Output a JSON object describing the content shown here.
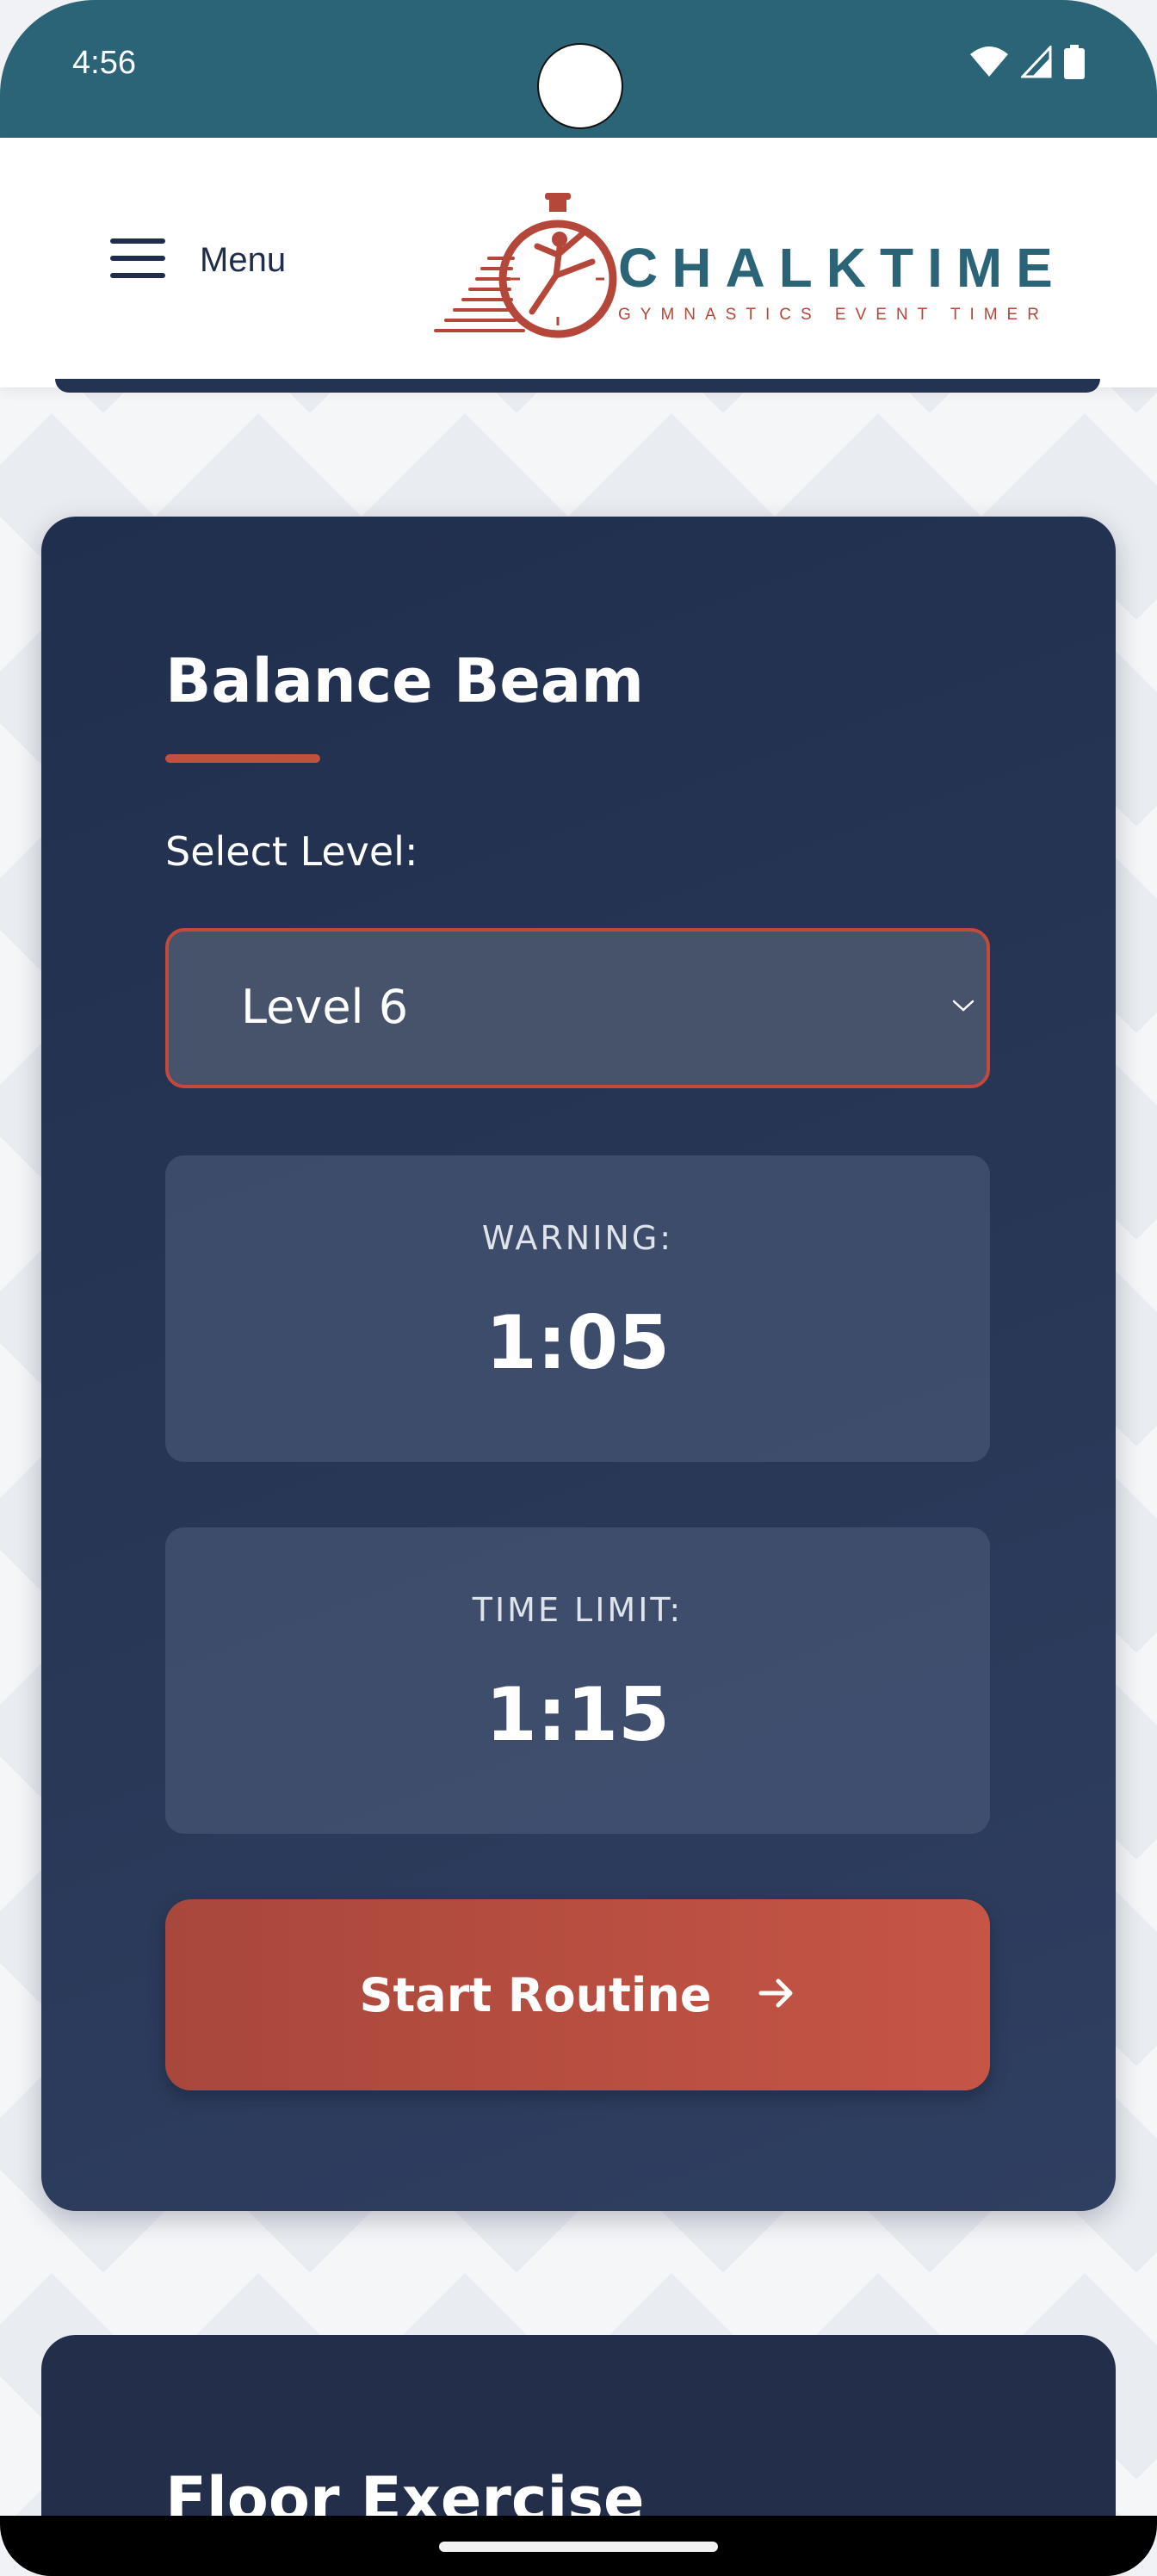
{
  "status_bar": {
    "time": "4:56"
  },
  "header": {
    "menu_label": "Menu",
    "logo_title": "CHALKTIME",
    "logo_subtitle": "GYMNASTICS EVENT TIMER"
  },
  "event_card": {
    "title": "Balance Beam",
    "select_label": "Select Level:",
    "selected_level": "Level 6",
    "warning_label": "WARNING:",
    "warning_time": "1:05",
    "limit_label": "TIME LIMIT:",
    "limit_time": "1:15",
    "start_button_label": "Start Routine"
  },
  "next_card": {
    "title": "Floor Exercise"
  },
  "colors": {
    "status_bar": "#2c6477",
    "card_bg": "#243352",
    "accent": "#c0503f",
    "logo_primary": "#2c6477"
  },
  "icons": {
    "menu": "hamburger-icon",
    "dropdown": "chevron-down-icon",
    "start_arrow": "arrow-right-icon",
    "wifi": "wifi-icon",
    "signal": "signal-icon",
    "battery": "battery-icon"
  }
}
